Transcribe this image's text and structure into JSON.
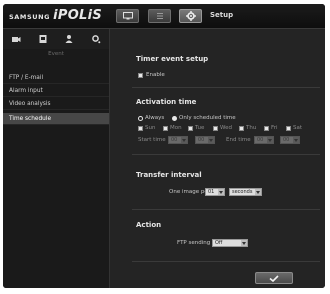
{
  "brand": {
    "maker": "SAMSUNG",
    "product": "iPOLiS"
  },
  "topbar": {
    "buttons": [
      {
        "icon": "monitor-icon",
        "active": false
      },
      {
        "icon": "list-icon",
        "active": false
      },
      {
        "icon": "gear-icon",
        "active": true
      }
    ],
    "setup_label": "Setup"
  },
  "sidebar": {
    "icons": [
      "camera-icon",
      "video-icon",
      "user-icon",
      "settings-icon"
    ],
    "category_title": "Event",
    "items": [
      {
        "label": "FTP / E-mail",
        "active": false
      },
      {
        "label": "Alarm input",
        "active": false
      },
      {
        "label": "Video analysis",
        "active": false
      },
      {
        "label": "Time schedule",
        "active": true
      }
    ]
  },
  "timer_event": {
    "title": "Timer event setup",
    "enable_label": "Enable",
    "enabled": false
  },
  "activation": {
    "title": "Activation time",
    "radio_always": "Always",
    "radio_scheduled": "Only scheduled time",
    "selected": "Always",
    "days": [
      "Sun",
      "Mon",
      "Tue",
      "Wed",
      "Thu",
      "Fri",
      "Sat"
    ],
    "start_time_label": "Start time",
    "start_hour": "00",
    "start_min": "00",
    "end_time_label": "End time",
    "end_hour": "00",
    "end_min": "00"
  },
  "transfer": {
    "title": "Transfer interval",
    "label": "One image per",
    "value": "01",
    "unit": "seconds"
  },
  "action": {
    "title": "Action",
    "ftp_label": "FTP sending",
    "ftp_value": "Off"
  },
  "apply_button": {
    "icon": "checkmark-icon"
  }
}
